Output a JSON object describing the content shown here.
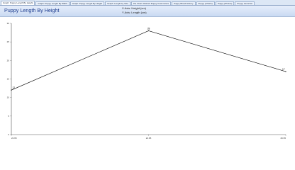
{
  "tabs": [
    {
      "label": "Graph: Puppy Length By Height",
      "active": true
    },
    {
      "label": "Graph: Puppy Length By Width",
      "active": false
    },
    {
      "label": "Graph: Puppy Length By Height",
      "active": false
    },
    {
      "label": "Graph: Length by Size",
      "active": false
    },
    {
      "label": "Pie Chart: Distinct Puppy Coat Colors",
      "active": false
    },
    {
      "label": "Puppy Breed History",
      "active": false
    },
    {
      "label": "Puppy (Charts)",
      "active": false
    },
    {
      "label": "Puppy (Photos)",
      "active": false
    },
    {
      "label": "Puppy Launcher",
      "active": false
    }
  ],
  "header": {
    "title": "Puppy Length By Height",
    "x_axis": "X Axis: Height (cm)",
    "y_axis": "Y Axis: Length (cm)"
  },
  "chart_data": {
    "type": "line",
    "x": [
      22.95,
      24.95,
      26.95
    ],
    "x_tick_labels": [
      "22.95",
      "24.95",
      "26.95"
    ],
    "series": [
      {
        "values": [
          12,
          28,
          17
        ],
        "data_labels": [
          "12",
          "28",
          "17"
        ]
      }
    ],
    "ylim": [
      0,
      30
    ],
    "y_ticks": [
      0,
      5,
      10,
      15,
      20,
      25,
      30
    ],
    "xlabel": "",
    "ylabel": "",
    "grid": false,
    "line_color": "#000000"
  }
}
